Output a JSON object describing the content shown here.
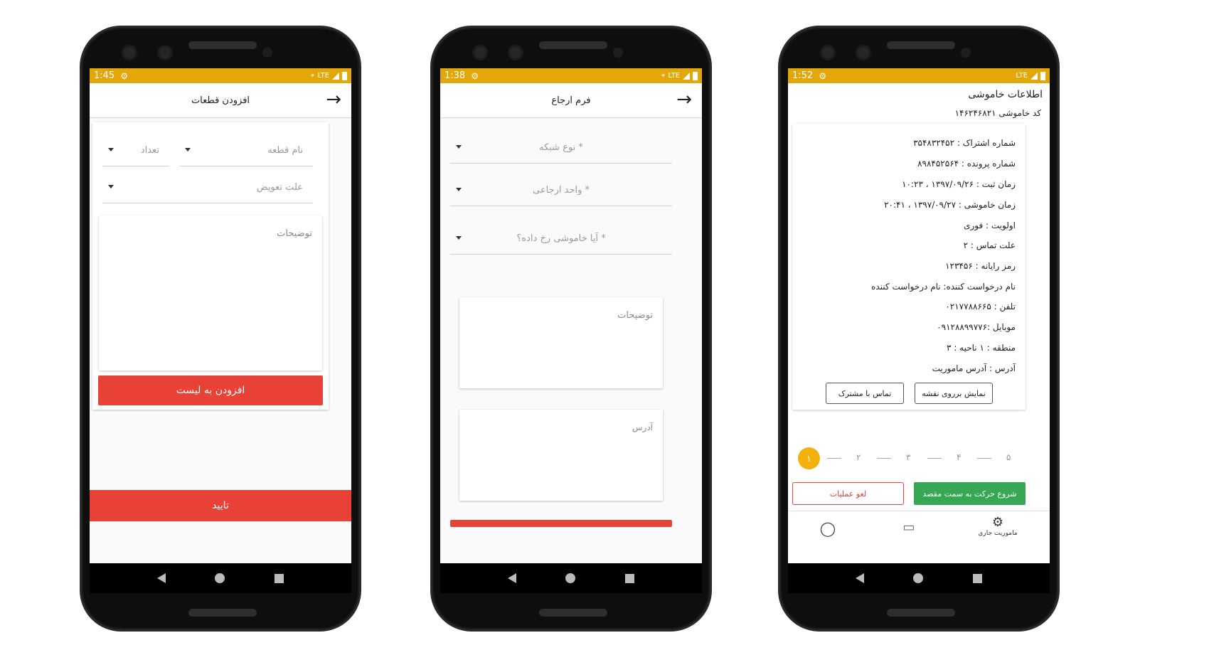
{
  "phone1": {
    "status": {
      "time": "1:45",
      "net": "LTE"
    },
    "title": "افزودن قطعات",
    "part_name_ph": "نام قطعه",
    "count_ph": "تعداد",
    "reason_ph": "علت تعویض",
    "desc_ph": "توضیحات",
    "add_btn": "افزودن به لیست",
    "confirm_btn": "تایید"
  },
  "phone2": {
    "status": {
      "time": "1:38",
      "net": "LTE"
    },
    "title": "فرم ارجاع",
    "network_ph": "* نوع شبکه",
    "unit_ph": "* واحد ارجاعی",
    "outage_ph": "* آیا خاموشی رخ داده؟",
    "desc_ph": "توضیحات",
    "address_ph": "آدرس"
  },
  "phone3": {
    "status": {
      "time": "1:52",
      "net": "LTE"
    },
    "heading": "اطلاعات خاموشی",
    "code": "کد خاموشی ۱۴۶۲۴۶۸۲۱",
    "lines": [
      "شماره اشتراک : ۳۵۴۸۳۲۴۵۲",
      "شماره پرونده : ۸۹۸۴۵۲۵۶۴",
      "زمان ثبت : ۱۳۹۷/۰۹/۲۶ ، ۱۰:۲۳",
      "زمان خاموشی : ۱۳۹۷/۰۹/۲۷ ، ۲۰:۴۱",
      "اولویت : فوری",
      "علت تماس : ۲",
      "رمز رایانه : ۱۲۳۴۵۶",
      "نام درخواست کننده: نام درخواست کننده",
      "تلفن : ۰۲۱۷۷۸۸۶۶۵",
      "موبایل :۰۹۱۲۸۸۹۹۷۷۶",
      "منطقه : ۱   ناحیه : ۳",
      "آدرس : آدرس ماموریت"
    ],
    "map_btn": "نمایش برروی نقشه",
    "call_btn": "تماس با مشترک",
    "steps": [
      "۱",
      "۲",
      "۳",
      "۴",
      "۵"
    ],
    "start_btn": "شروع حرکت به سمت مقصد",
    "cancel_btn": "لغو عملیات",
    "tab_current": "ماموریت جاری",
    "colors": {
      "accent": "#e4a70a",
      "green": "#36a853",
      "red": "#e84237"
    }
  }
}
